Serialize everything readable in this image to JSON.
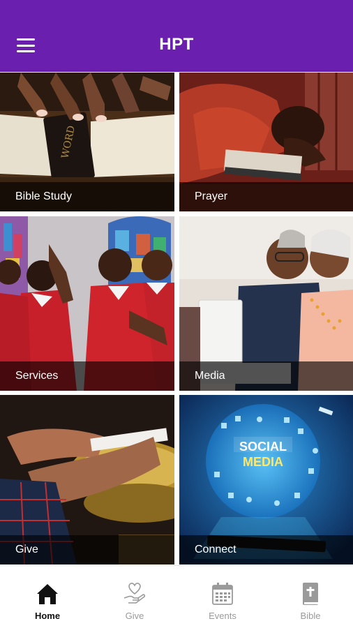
{
  "header": {
    "title": "HPT",
    "menu_icon": "hamburger-menu-icon",
    "background_color": "#6a1fae"
  },
  "tiles": [
    {
      "label": "Bible Study"
    },
    {
      "label": "Prayer"
    },
    {
      "label": "Services"
    },
    {
      "label": "Media"
    },
    {
      "label": "Give"
    },
    {
      "label": "Connect"
    }
  ],
  "tabbar": {
    "active": "Home",
    "items": [
      {
        "label": "Home",
        "icon": "home-icon"
      },
      {
        "label": "Give",
        "icon": "heart-hand-icon"
      },
      {
        "label": "Events",
        "icon": "calendar-icon"
      },
      {
        "label": "Bible",
        "icon": "bible-icon"
      }
    ]
  }
}
